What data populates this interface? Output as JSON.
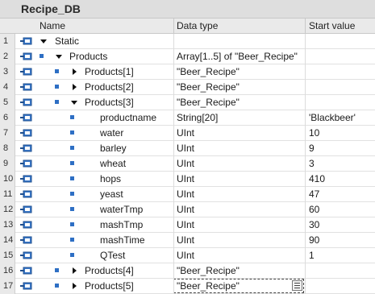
{
  "window": {
    "title": "Recipe_DB"
  },
  "columns": {
    "name": "Name",
    "data_type": "Data type",
    "start_value": "Start value"
  },
  "rows": [
    {
      "num": "1",
      "name": "Static",
      "type": "",
      "start": "",
      "level": 0,
      "expander": "down"
    },
    {
      "num": "2",
      "name": "Products",
      "type": "Array[1..5] of \"Beer_Recipe\"",
      "start": "",
      "level": 1,
      "expander": "down"
    },
    {
      "num": "3",
      "name": "Products[1]",
      "type": "\"Beer_Recipe\"",
      "start": "",
      "level": 2,
      "expander": "right"
    },
    {
      "num": "4",
      "name": "Products[2]",
      "type": "\"Beer_Recipe\"",
      "start": "",
      "level": 2,
      "expander": "right"
    },
    {
      "num": "5",
      "name": "Products[3]",
      "type": "\"Beer_Recipe\"",
      "start": "",
      "level": 2,
      "expander": "down"
    },
    {
      "num": "6",
      "name": "productname",
      "type": "String[20]",
      "start": "'Blackbeer'",
      "level": 3,
      "expander": ""
    },
    {
      "num": "7",
      "name": "water",
      "type": "UInt",
      "start": "10",
      "level": 3,
      "expander": ""
    },
    {
      "num": "8",
      "name": "barley",
      "type": "UInt",
      "start": "9",
      "level": 3,
      "expander": ""
    },
    {
      "num": "9",
      "name": "wheat",
      "type": "UInt",
      "start": "3",
      "level": 3,
      "expander": ""
    },
    {
      "num": "10",
      "name": "hops",
      "type": "UInt",
      "start": "410",
      "level": 3,
      "expander": ""
    },
    {
      "num": "11",
      "name": "yeast",
      "type": "UInt",
      "start": "47",
      "level": 3,
      "expander": ""
    },
    {
      "num": "12",
      "name": "waterTmp",
      "type": "UInt",
      "start": "60",
      "level": 3,
      "expander": ""
    },
    {
      "num": "13",
      "name": "mashTmp",
      "type": "UInt",
      "start": "30",
      "level": 3,
      "expander": ""
    },
    {
      "num": "14",
      "name": "mashTime",
      "type": "UInt",
      "start": "90",
      "level": 3,
      "expander": ""
    },
    {
      "num": "15",
      "name": "QTest",
      "type": "UInt",
      "start": "1",
      "level": 3,
      "expander": ""
    },
    {
      "num": "16",
      "name": "Products[4]",
      "type": "\"Beer_Recipe\"",
      "start": "",
      "level": 2,
      "expander": "right"
    },
    {
      "num": "17",
      "name": "Products[5]",
      "type": "\"Beer_Recipe\"",
      "start": "",
      "level": 2,
      "expander": "right",
      "selected": true
    }
  ],
  "icons": {
    "row_icon": "interface-io-icon",
    "member_marker": "member-square-icon",
    "picker": "type-picker-icon"
  },
  "colors": {
    "accent_blue": "#2e6fc4"
  }
}
